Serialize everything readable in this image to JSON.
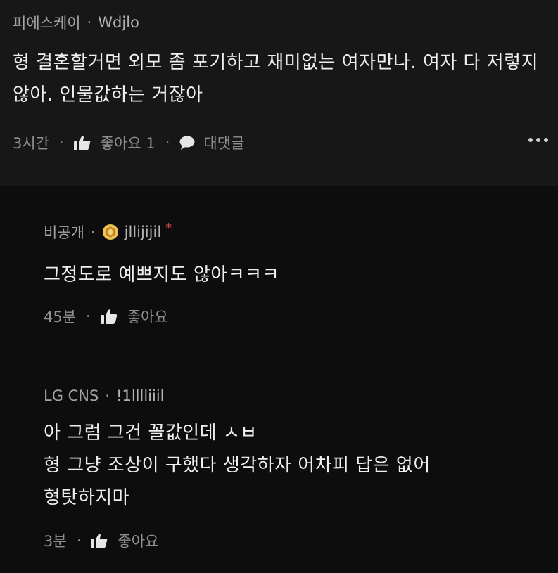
{
  "post": {
    "company": "피에스케이",
    "nickname": "Wdjlo",
    "body": "형 결혼할거면 외모 좀 포기하고 재미없는 여자만나. 여자 다 저렇지않아. 인물값하는 거잖아",
    "time": "3시간",
    "like_label": "좋아요 1",
    "reply_label": "대댓글",
    "more_icon": "more-dots-icon"
  },
  "replies": [
    {
      "company": "비공개",
      "nickname": "jllijijil",
      "star": "*",
      "body": "그정도로 예쁘지도 않아ㅋㅋㅋ",
      "time": "45분",
      "like_label": "좋아요",
      "badge_color": "#e8b23a"
    },
    {
      "company": "LG CNS",
      "nickname": "!1lllliiil",
      "body_lines": [
        "아 그럼 그건 꼴값인데 ㅅㅂ",
        "형 그냥 조상이 구했다 생각하자 어차피 답은 없어",
        "형탓하지마"
      ],
      "time": "3분",
      "like_label": "좋아요"
    }
  ],
  "separator": "·",
  "colors": {
    "background": "#0d0d0d",
    "post_background": "#171717",
    "text": "#ececec",
    "muted": "#8f8f8f"
  }
}
